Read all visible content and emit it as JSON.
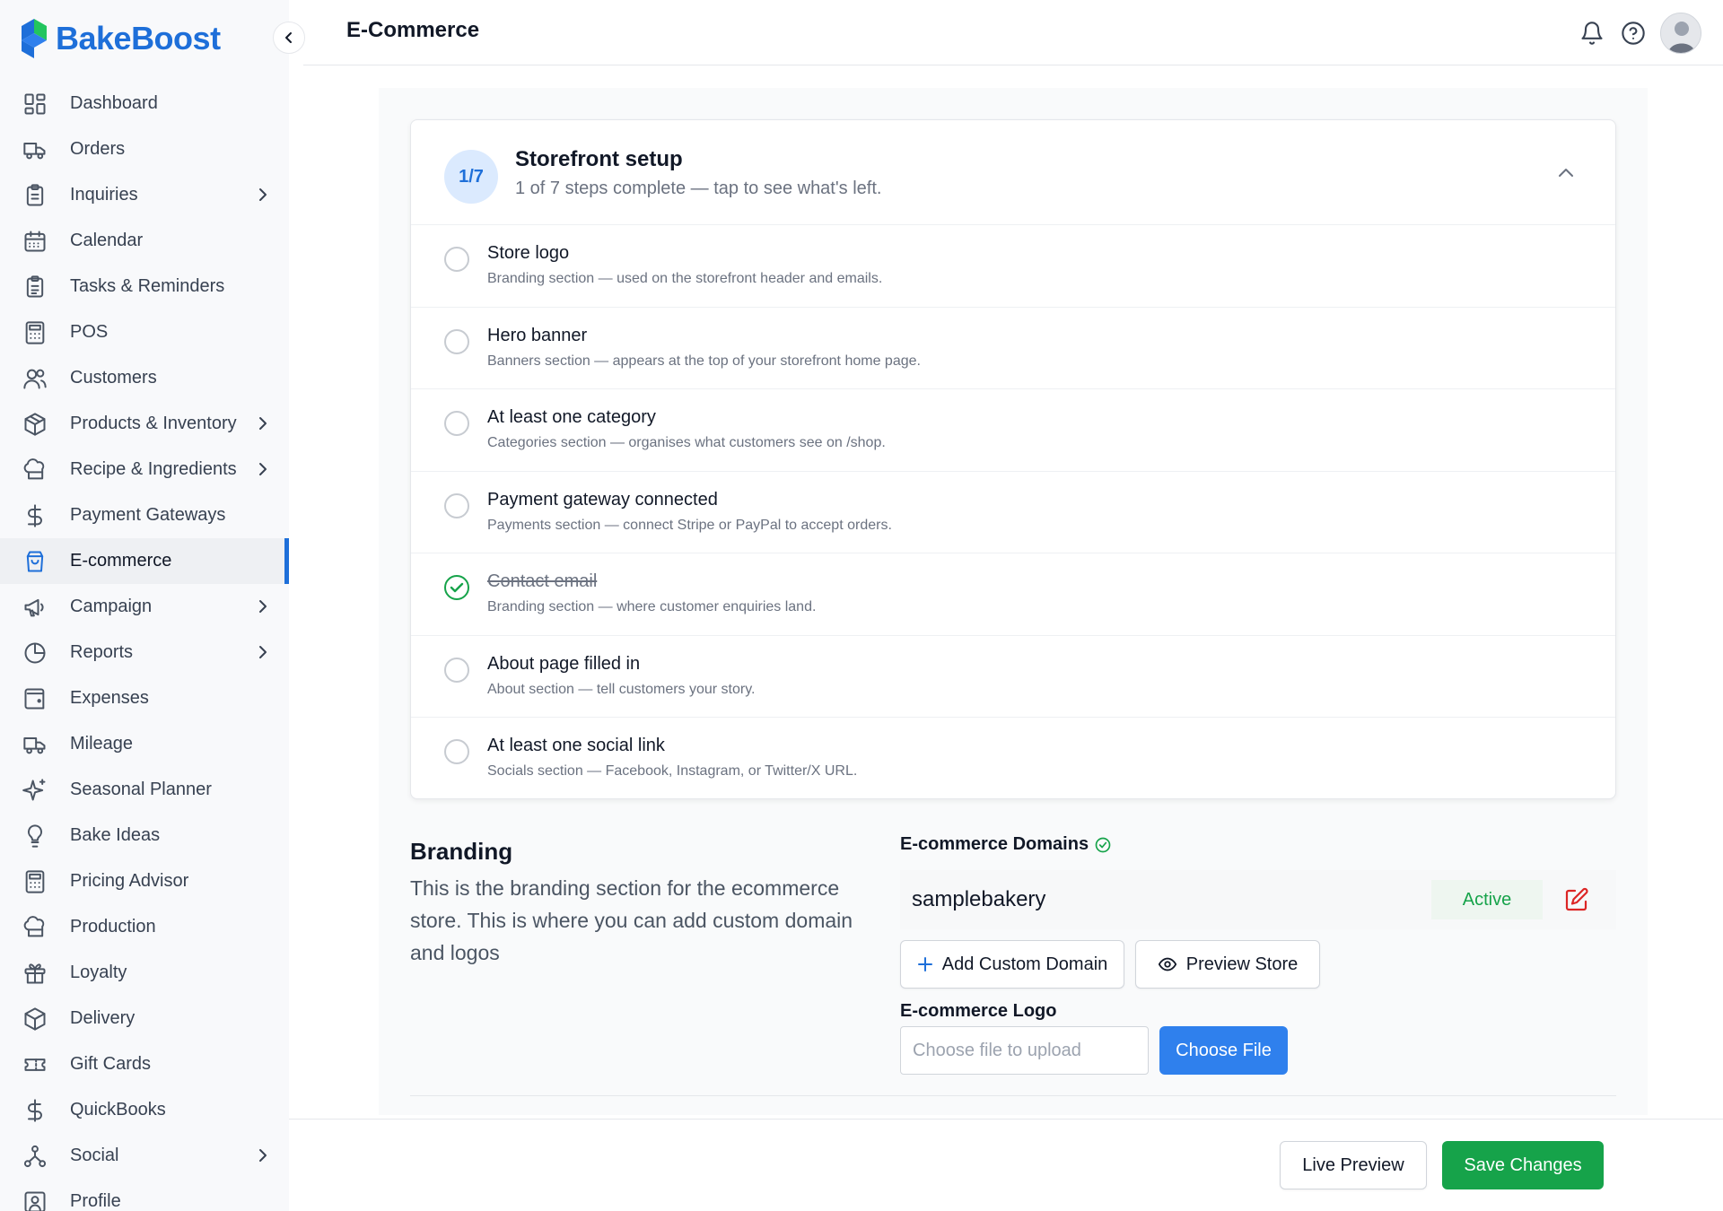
{
  "brand": {
    "name": "BakeBoost",
    "primary_color": "#1e6fd9"
  },
  "sidebar": {
    "items": [
      {
        "label": "Dashboard",
        "icon": "dashboard-icon",
        "chevron": false,
        "active": false
      },
      {
        "label": "Orders",
        "icon": "truck-icon",
        "chevron": false,
        "active": false
      },
      {
        "label": "Inquiries",
        "icon": "clipboard-icon",
        "chevron": true,
        "active": false
      },
      {
        "label": "Calendar",
        "icon": "calendar-icon",
        "chevron": false,
        "active": false
      },
      {
        "label": "Tasks & Reminders",
        "icon": "clipboard-list-icon",
        "chevron": false,
        "active": false
      },
      {
        "label": "POS",
        "icon": "calculator-icon",
        "chevron": false,
        "active": false
      },
      {
        "label": "Customers",
        "icon": "users-icon",
        "chevron": false,
        "active": false
      },
      {
        "label": "Products & Inventory",
        "icon": "box-icon",
        "chevron": true,
        "active": false
      },
      {
        "label": "Recipe & Ingredients",
        "icon": "chef-hat-icon",
        "chevron": true,
        "active": false
      },
      {
        "label": "Payment Gateways",
        "icon": "dollar-icon",
        "chevron": false,
        "active": false
      },
      {
        "label": "E-commerce",
        "icon": "shopping-bag-icon",
        "chevron": false,
        "active": true
      },
      {
        "label": "Campaign",
        "icon": "megaphone-icon",
        "chevron": true,
        "active": false
      },
      {
        "label": "Reports",
        "icon": "pie-chart-icon",
        "chevron": true,
        "active": false
      },
      {
        "label": "Expenses",
        "icon": "wallet-icon",
        "chevron": false,
        "active": false
      },
      {
        "label": "Mileage",
        "icon": "truck-icon",
        "chevron": false,
        "active": false
      },
      {
        "label": "Seasonal Planner",
        "icon": "sparkles-icon",
        "chevron": false,
        "active": false
      },
      {
        "label": "Bake Ideas",
        "icon": "lightbulb-icon",
        "chevron": false,
        "active": false
      },
      {
        "label": "Pricing Advisor",
        "icon": "calculator-icon",
        "chevron": false,
        "active": false
      },
      {
        "label": "Production",
        "icon": "chef-hat-icon",
        "chevron": false,
        "active": false
      },
      {
        "label": "Loyalty",
        "icon": "gift-icon",
        "chevron": false,
        "active": false
      },
      {
        "label": "Delivery",
        "icon": "package-icon",
        "chevron": false,
        "active": false
      },
      {
        "label": "Gift Cards",
        "icon": "ticket-icon",
        "chevron": false,
        "active": false
      },
      {
        "label": "QuickBooks",
        "icon": "dollar-icon",
        "chevron": false,
        "active": false
      },
      {
        "label": "Social",
        "icon": "network-icon",
        "chevron": true,
        "active": false
      },
      {
        "label": "Profile",
        "icon": "user-square-icon",
        "chevron": false,
        "active": false
      }
    ]
  },
  "header": {
    "title": "E-Commerce"
  },
  "setup": {
    "badge": "1/7",
    "title": "Storefront setup",
    "subtitle": "1 of 7 steps complete — tap to see what's left.",
    "steps": [
      {
        "title": "Store logo",
        "desc": "Branding section — used on the storefront header and emails.",
        "done": false
      },
      {
        "title": "Hero banner",
        "desc": "Banners section — appears at the top of your storefront home page.",
        "done": false
      },
      {
        "title": "At least one category",
        "desc": "Categories section — organises what customers see on /shop.",
        "done": false
      },
      {
        "title": "Payment gateway connected",
        "desc": "Payments section — connect Stripe or PayPal to accept orders.",
        "done": false
      },
      {
        "title": "Contact email",
        "desc": "Branding section — where customer enquiries land.",
        "done": true
      },
      {
        "title": "About page filled in",
        "desc": "About section — tell customers your story.",
        "done": false
      },
      {
        "title": "At least one social link",
        "desc": "Socials section — Facebook, Instagram, or Twitter/X URL.",
        "done": false
      }
    ]
  },
  "branding": {
    "title": "Branding",
    "description": "This is the branding section for the ecommerce store. This is where you can add custom domain and logos",
    "domains_label": "E-commerce Domains",
    "domain": {
      "name": "samplebakery",
      "status": "Active"
    },
    "add_domain_label": "Add Custom Domain",
    "preview_store_label": "Preview Store",
    "logo_label": "E-commerce Logo",
    "file_placeholder": "Choose file to upload",
    "choose_file_label": "Choose File"
  },
  "footer": {
    "live_preview_label": "Live Preview",
    "save_label": "Save Changes"
  },
  "colors": {
    "accent": "#1e6fd9",
    "success": "#16a34a",
    "danger": "#dc2626",
    "button_blue": "#2f80ed"
  }
}
